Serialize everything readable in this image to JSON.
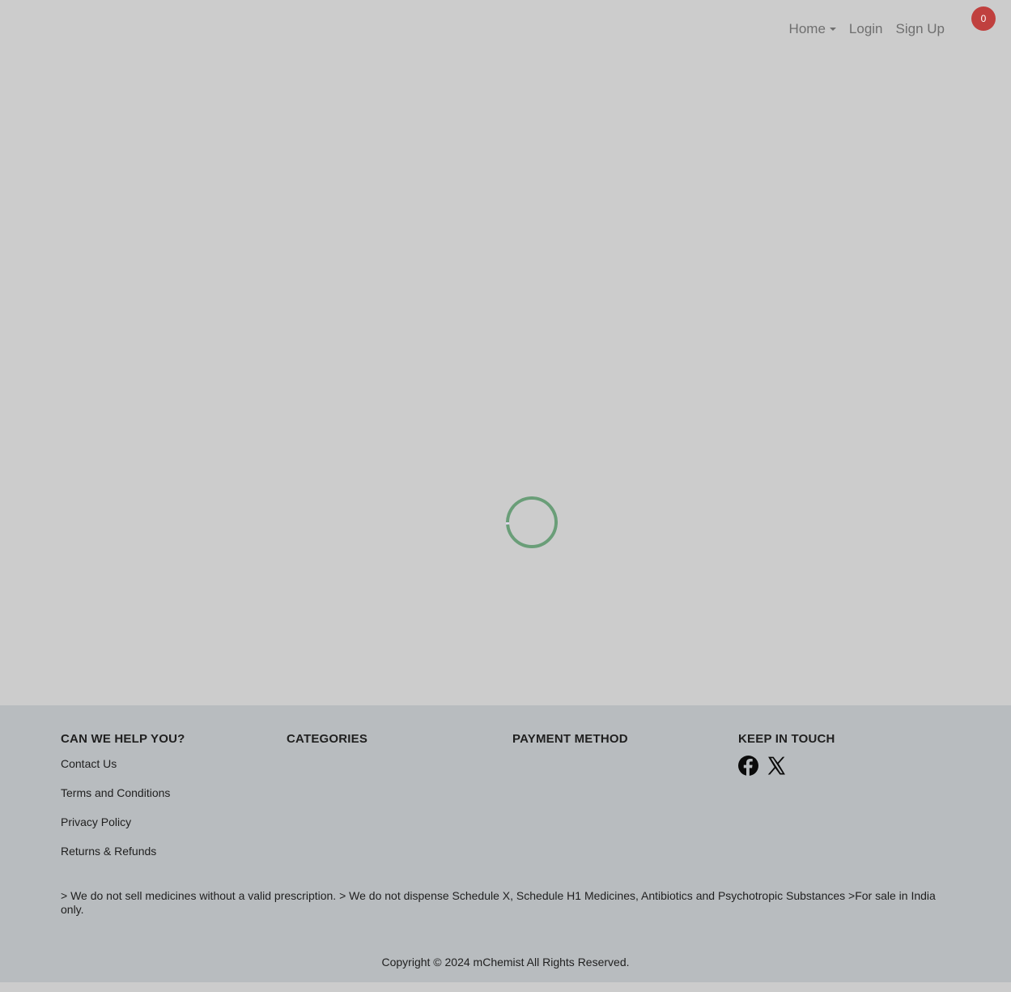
{
  "header": {
    "nav": {
      "home_label": "Home",
      "login_label": "Login",
      "signup_label": "Sign Up"
    },
    "cart": {
      "count": "0"
    }
  },
  "footer": {
    "help": {
      "title": "CAN WE HELP YOU?",
      "links": [
        "Contact Us",
        "Terms and Conditions",
        "Privacy Policy",
        "Returns & Refunds"
      ]
    },
    "categories": {
      "title": "CATEGORIES"
    },
    "payment": {
      "title": "PAYMENT METHOD"
    },
    "social": {
      "title": "KEEP IN TOUCH",
      "icons": [
        "facebook-icon",
        "x-icon"
      ]
    },
    "disclaimer": "> We do not sell medicines without a valid prescription. > We do not dispense Schedule X, Schedule H1 Medicines, Antibiotics and Psychotropic Substances >For sale in India only.",
    "copyright": "Copyright © 2024 mChemist All Rights Reserved."
  },
  "colors": {
    "overlay": "#cccccc",
    "footer_bg": "#b8bcbf",
    "cart_badge": "#c0403e",
    "spinner_primary": "#6a9e78",
    "spinner_secondary": "#e4d8f0"
  }
}
